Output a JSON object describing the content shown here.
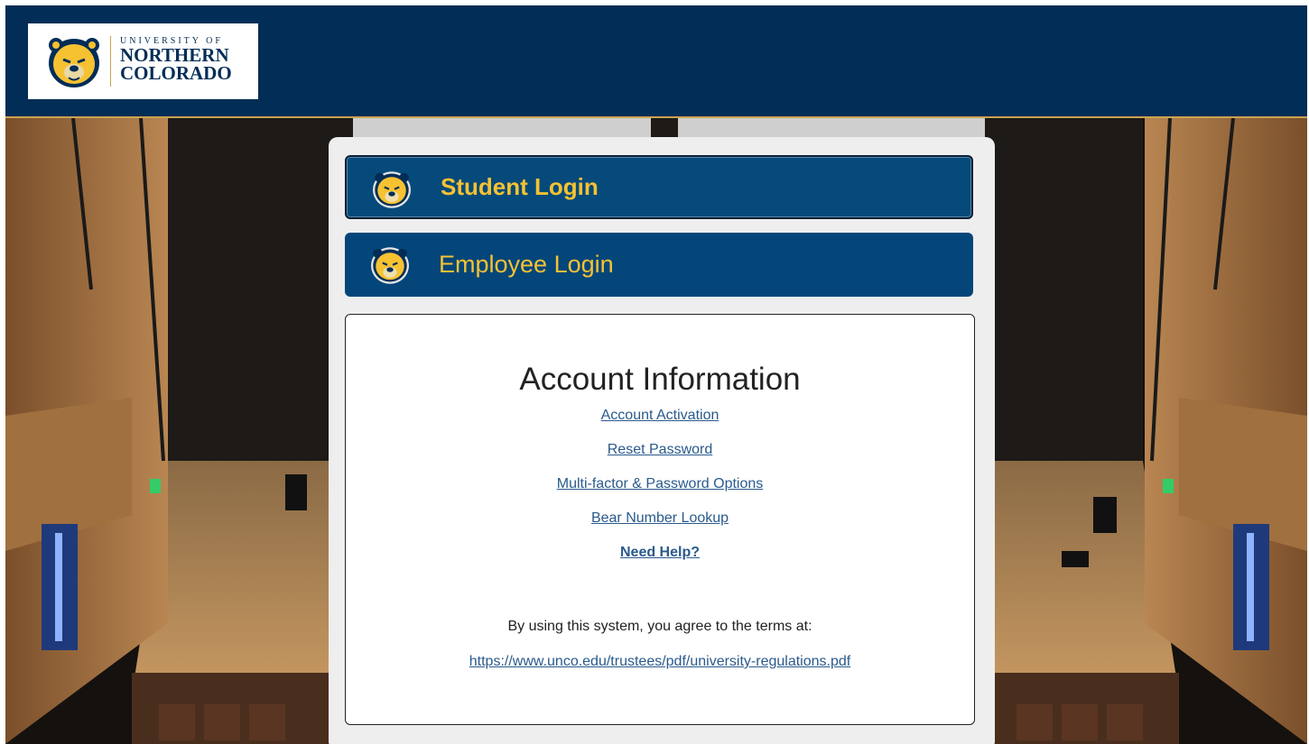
{
  "brand": {
    "line1": "UNIVERSITY OF",
    "line2": "NORTHERN",
    "line3": "COLORADO",
    "colors": {
      "navy": "#022d56",
      "gold": "#f7c232",
      "button": "#054b7c"
    }
  },
  "login": {
    "student_label": "Student Login",
    "employee_label": "Employee Login",
    "icon": "bear-logo-icon"
  },
  "account": {
    "title": "Account Information",
    "links": {
      "activation": "Account Activation",
      "reset": "Reset Password",
      "mfa": "Multi-factor & Password Options",
      "bear_number": "Bear Number Lookup",
      "help": "Need Help?"
    },
    "terms_text": "By using this system, you agree to the terms at:",
    "terms_link": "https://www.unco.edu/trustees/pdf/university-regulations.pdf"
  }
}
